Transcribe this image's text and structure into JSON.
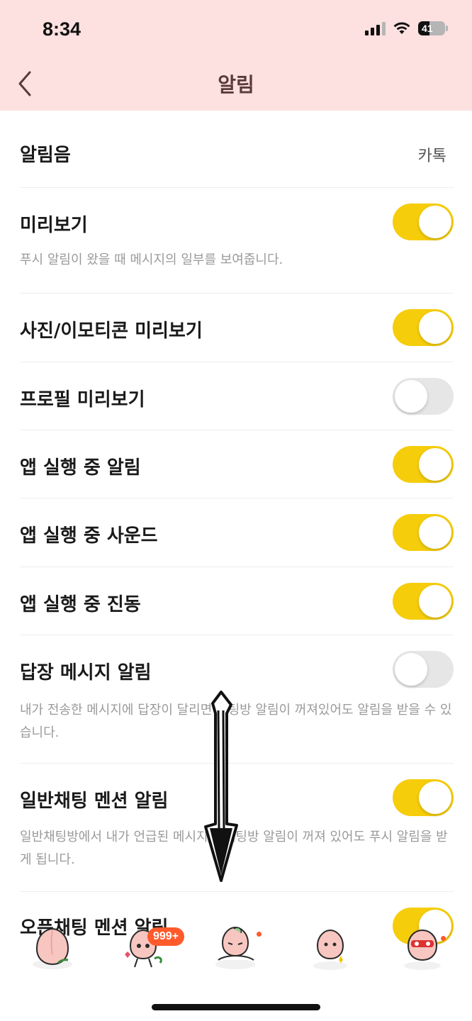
{
  "status_bar": {
    "time": "8:34",
    "battery": "41",
    "battery_level": 0.41
  },
  "header": {
    "title": "알림",
    "back_icon": "chevron-left-icon"
  },
  "settings": {
    "sound": {
      "label": "알림음",
      "value": "카톡"
    },
    "preview": {
      "label": "미리보기",
      "on": true,
      "description": "푸시 알림이 왔을 때 메시지의 일부를 보여줍니다."
    },
    "photo_preview": {
      "label": "사진/이모티콘 미리보기",
      "on": true
    },
    "profile_preview": {
      "label": "프로필 미리보기",
      "on": false
    },
    "app_notification": {
      "label": "앱 실행 중 알림",
      "on": true
    },
    "app_sound": {
      "label": "앱 실행 중 사운드",
      "on": true
    },
    "app_vibration": {
      "label": "앱 실행 중 진동",
      "on": true
    },
    "reply_notification": {
      "label": "답장 메시지 알림",
      "on": false,
      "description": "내가 전송한 메시지에 답장이 달리면 채팅방 알림이 꺼져있어도 알림을 받을 수 있습니다."
    },
    "mention_notification": {
      "label": "일반채팅 멘션 알림",
      "on": true,
      "description": "일반채팅방에서 내가 언급된 메시지는 채팅방 알림이 꺼져 있어도 푸시 알림을 받게 됩니다."
    },
    "open_mention_notification": {
      "label": "오픈채팅 멘션 알림",
      "on": true
    }
  },
  "tabbar": {
    "badge": "999+",
    "accent": "#ff5a2c",
    "tabs": [
      "friends-tab-icon",
      "chats-tab-icon",
      "openchat-tab-icon",
      "shopping-tab-icon",
      "more-tab-icon"
    ]
  },
  "colors": {
    "header_bg": "#fde0e0",
    "toggle_on": "#f6cd0b",
    "toggle_off": "#e6e6e6",
    "title": "#5a3a3a"
  }
}
